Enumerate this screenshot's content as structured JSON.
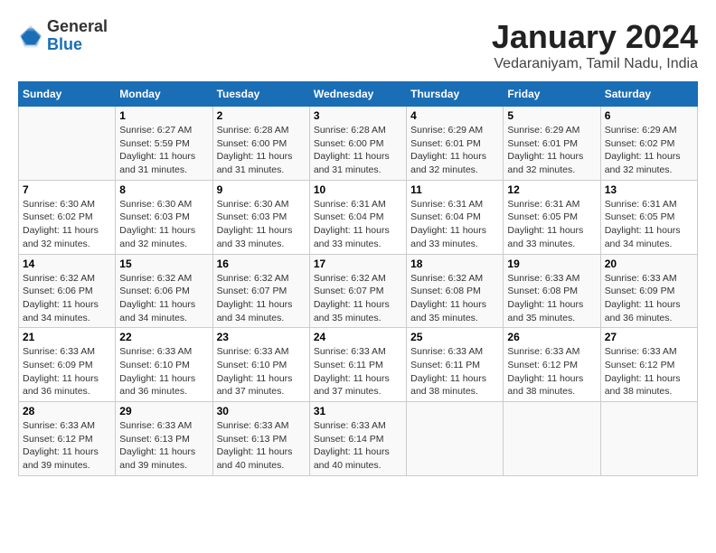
{
  "header": {
    "logo_general": "General",
    "logo_blue": "Blue",
    "title": "January 2024",
    "subtitle": "Vedaraniyam, Tamil Nadu, India"
  },
  "days_of_week": [
    "Sunday",
    "Monday",
    "Tuesday",
    "Wednesday",
    "Thursday",
    "Friday",
    "Saturday"
  ],
  "weeks": [
    [
      {
        "day": "",
        "details": ""
      },
      {
        "day": "1",
        "details": "Sunrise: 6:27 AM\nSunset: 5:59 PM\nDaylight: 11 hours\nand 31 minutes."
      },
      {
        "day": "2",
        "details": "Sunrise: 6:28 AM\nSunset: 6:00 PM\nDaylight: 11 hours\nand 31 minutes."
      },
      {
        "day": "3",
        "details": "Sunrise: 6:28 AM\nSunset: 6:00 PM\nDaylight: 11 hours\nand 31 minutes."
      },
      {
        "day": "4",
        "details": "Sunrise: 6:29 AM\nSunset: 6:01 PM\nDaylight: 11 hours\nand 32 minutes."
      },
      {
        "day": "5",
        "details": "Sunrise: 6:29 AM\nSunset: 6:01 PM\nDaylight: 11 hours\nand 32 minutes."
      },
      {
        "day": "6",
        "details": "Sunrise: 6:29 AM\nSunset: 6:02 PM\nDaylight: 11 hours\nand 32 minutes."
      }
    ],
    [
      {
        "day": "7",
        "details": "Sunrise: 6:30 AM\nSunset: 6:02 PM\nDaylight: 11 hours\nand 32 minutes."
      },
      {
        "day": "8",
        "details": "Sunrise: 6:30 AM\nSunset: 6:03 PM\nDaylight: 11 hours\nand 32 minutes."
      },
      {
        "day": "9",
        "details": "Sunrise: 6:30 AM\nSunset: 6:03 PM\nDaylight: 11 hours\nand 33 minutes."
      },
      {
        "day": "10",
        "details": "Sunrise: 6:31 AM\nSunset: 6:04 PM\nDaylight: 11 hours\nand 33 minutes."
      },
      {
        "day": "11",
        "details": "Sunrise: 6:31 AM\nSunset: 6:04 PM\nDaylight: 11 hours\nand 33 minutes."
      },
      {
        "day": "12",
        "details": "Sunrise: 6:31 AM\nSunset: 6:05 PM\nDaylight: 11 hours\nand 33 minutes."
      },
      {
        "day": "13",
        "details": "Sunrise: 6:31 AM\nSunset: 6:05 PM\nDaylight: 11 hours\nand 34 minutes."
      }
    ],
    [
      {
        "day": "14",
        "details": "Sunrise: 6:32 AM\nSunset: 6:06 PM\nDaylight: 11 hours\nand 34 minutes."
      },
      {
        "day": "15",
        "details": "Sunrise: 6:32 AM\nSunset: 6:06 PM\nDaylight: 11 hours\nand 34 minutes."
      },
      {
        "day": "16",
        "details": "Sunrise: 6:32 AM\nSunset: 6:07 PM\nDaylight: 11 hours\nand 34 minutes."
      },
      {
        "day": "17",
        "details": "Sunrise: 6:32 AM\nSunset: 6:07 PM\nDaylight: 11 hours\nand 35 minutes."
      },
      {
        "day": "18",
        "details": "Sunrise: 6:32 AM\nSunset: 6:08 PM\nDaylight: 11 hours\nand 35 minutes."
      },
      {
        "day": "19",
        "details": "Sunrise: 6:33 AM\nSunset: 6:08 PM\nDaylight: 11 hours\nand 35 minutes."
      },
      {
        "day": "20",
        "details": "Sunrise: 6:33 AM\nSunset: 6:09 PM\nDaylight: 11 hours\nand 36 minutes."
      }
    ],
    [
      {
        "day": "21",
        "details": "Sunrise: 6:33 AM\nSunset: 6:09 PM\nDaylight: 11 hours\nand 36 minutes."
      },
      {
        "day": "22",
        "details": "Sunrise: 6:33 AM\nSunset: 6:10 PM\nDaylight: 11 hours\nand 36 minutes."
      },
      {
        "day": "23",
        "details": "Sunrise: 6:33 AM\nSunset: 6:10 PM\nDaylight: 11 hours\nand 37 minutes."
      },
      {
        "day": "24",
        "details": "Sunrise: 6:33 AM\nSunset: 6:11 PM\nDaylight: 11 hours\nand 37 minutes."
      },
      {
        "day": "25",
        "details": "Sunrise: 6:33 AM\nSunset: 6:11 PM\nDaylight: 11 hours\nand 38 minutes."
      },
      {
        "day": "26",
        "details": "Sunrise: 6:33 AM\nSunset: 6:12 PM\nDaylight: 11 hours\nand 38 minutes."
      },
      {
        "day": "27",
        "details": "Sunrise: 6:33 AM\nSunset: 6:12 PM\nDaylight: 11 hours\nand 38 minutes."
      }
    ],
    [
      {
        "day": "28",
        "details": "Sunrise: 6:33 AM\nSunset: 6:12 PM\nDaylight: 11 hours\nand 39 minutes."
      },
      {
        "day": "29",
        "details": "Sunrise: 6:33 AM\nSunset: 6:13 PM\nDaylight: 11 hours\nand 39 minutes."
      },
      {
        "day": "30",
        "details": "Sunrise: 6:33 AM\nSunset: 6:13 PM\nDaylight: 11 hours\nand 40 minutes."
      },
      {
        "day": "31",
        "details": "Sunrise: 6:33 AM\nSunset: 6:14 PM\nDaylight: 11 hours\nand 40 minutes."
      },
      {
        "day": "",
        "details": ""
      },
      {
        "day": "",
        "details": ""
      },
      {
        "day": "",
        "details": ""
      }
    ]
  ]
}
